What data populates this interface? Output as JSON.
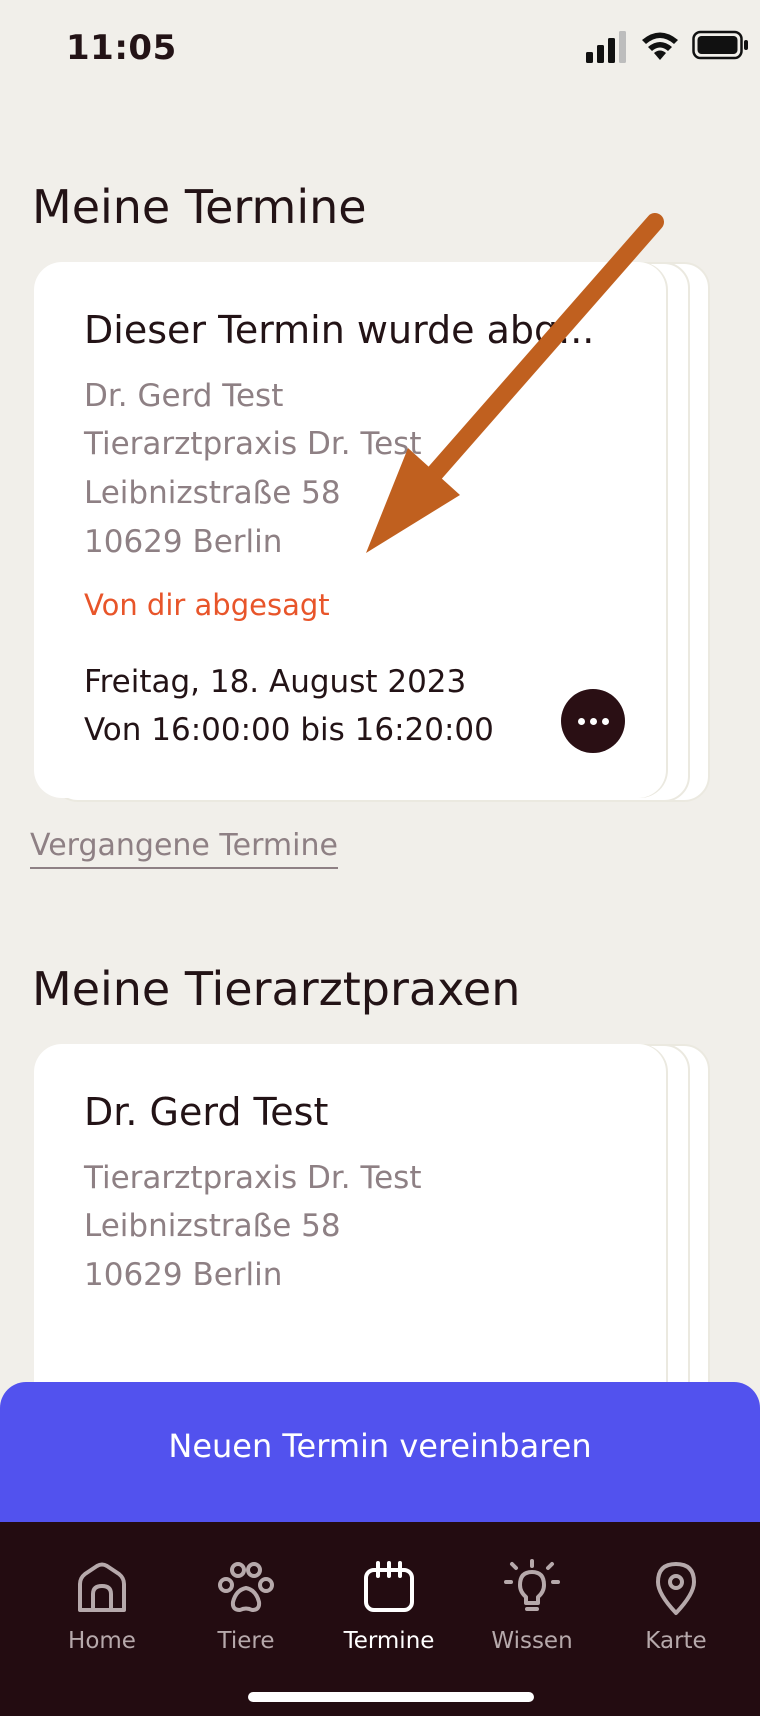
{
  "status_bar": {
    "time": "11:05"
  },
  "appointments": {
    "heading": "Meine Termine",
    "card": {
      "title": "Dieser Termin wurde abg...",
      "vet_name": "Dr. Gerd Test",
      "practice": "Tierarztpraxis Dr. Test",
      "street": "Leibnizstraße 58",
      "city": "10629 Berlin",
      "status": "Von dir abgesagt",
      "date": "Freitag, 18. August 2023",
      "time_range": "Von 16:00:00 bis 16:20:00"
    },
    "past_link": "Vergangene Termine"
  },
  "practices": {
    "heading": "Meine Tierarztpraxen",
    "card": {
      "title": "Dr. Gerd Test",
      "practice": "Tierarztpraxis Dr. Test",
      "street": "Leibnizstraße 58",
      "city": "10629 Berlin"
    }
  },
  "primary_action": {
    "label": "Neuen Termin vereinbaren"
  },
  "tab_bar": {
    "items": [
      {
        "label": "Home",
        "icon": "home-icon"
      },
      {
        "label": "Tiere",
        "icon": "paw-icon"
      },
      {
        "label": "Termine",
        "icon": "calendar-icon",
        "active": true
      },
      {
        "label": "Wissen",
        "icon": "lightbulb-icon"
      },
      {
        "label": "Karte",
        "icon": "map-pin-icon"
      }
    ]
  },
  "colors": {
    "background": "#f1efea",
    "accent": "#5252ee",
    "cancel": "#e8552a",
    "tab_bar": "#230c11",
    "annotation_arrow": "#c0601f"
  }
}
